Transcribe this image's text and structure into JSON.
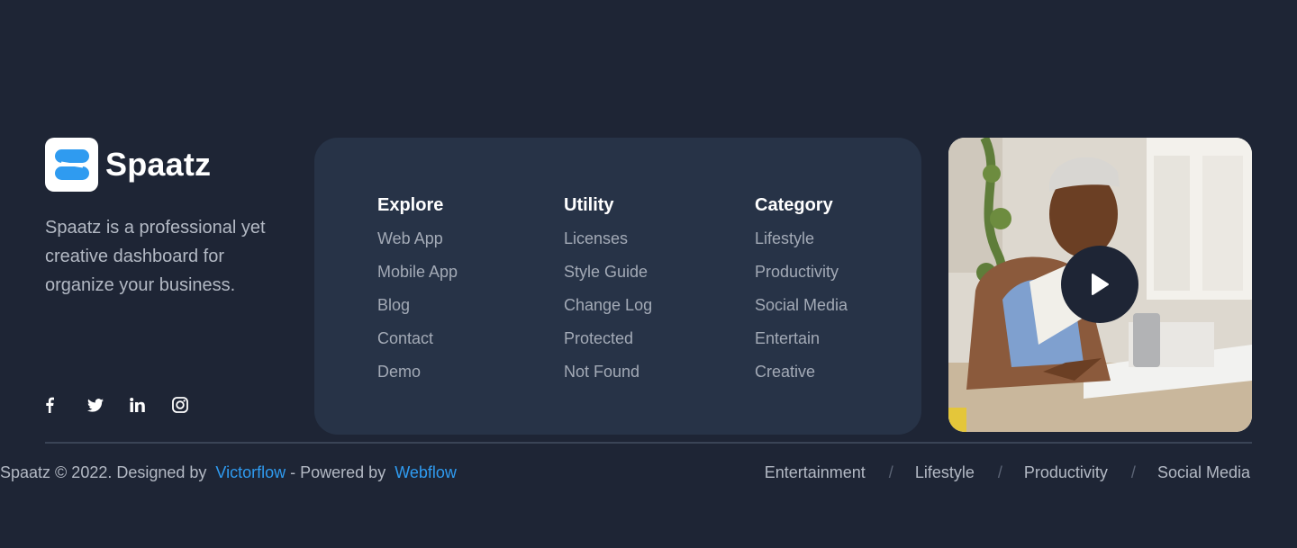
{
  "brand": {
    "name": "Spaatz",
    "description": "Spaatz is a professional yet creative dashboard for organize your business.",
    "accent": "#2f9bf0"
  },
  "socials": [
    {
      "icon": "facebook-icon"
    },
    {
      "icon": "twitter-icon"
    },
    {
      "icon": "linkedin-icon"
    },
    {
      "icon": "instagram-icon"
    }
  ],
  "columns": {
    "explore": {
      "title": "Explore",
      "items": [
        "Web App",
        "Mobile App",
        "Blog",
        "Contact",
        "Demo"
      ]
    },
    "utility": {
      "title": "Utility",
      "items": [
        "Licenses",
        "Style Guide",
        "Change Log",
        "Protected",
        "Not Found"
      ]
    },
    "category": {
      "title": "Category",
      "items": [
        "Lifestyle",
        "Productivity",
        "Social Media",
        "Entertain",
        "Creative"
      ]
    }
  },
  "video": {
    "play_icon": "play-icon"
  },
  "copyright": {
    "prefix": "Spaatz © 2022. Designed by",
    "designer": "Victorflow",
    "middle": "- Powered by",
    "platform": "Webflow"
  },
  "bottom_nav": {
    "items": [
      "Entertainment",
      "Lifestyle",
      "Productivity",
      "Social Media"
    ],
    "separator": "/"
  }
}
